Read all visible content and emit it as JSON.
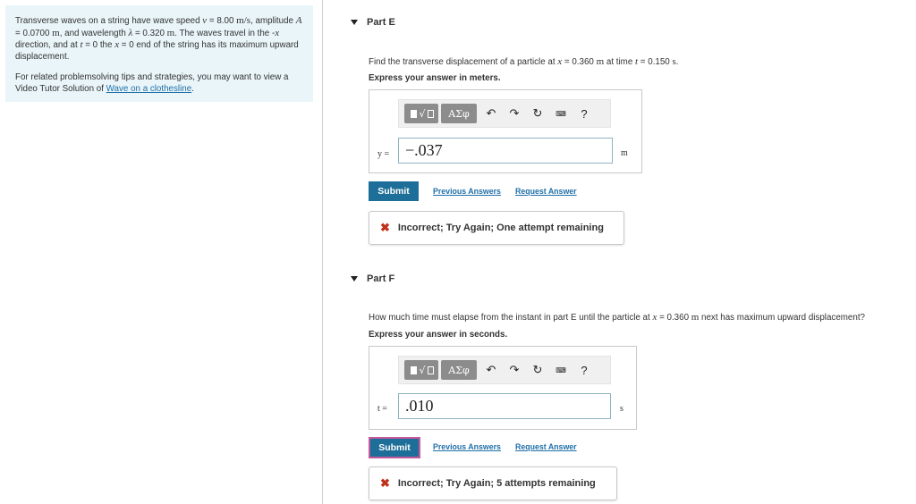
{
  "problem": {
    "intro": {
      "t1": "Transverse waves on a string have wave speed ",
      "v_sym": "v",
      "t2": " = 8.00 ",
      "v_unit": "m/s",
      "t3": ", amplitude ",
      "A_sym": "A",
      "t4": " = 0.0700 ",
      "A_unit": "m",
      "t5": ", and wavelength ",
      "lambda_sym": "λ",
      "t6": " = 0.320 ",
      "lambda_unit": "m",
      "t7": ". The waves travel in the -",
      "x_sym1": "x",
      "t8": " direction, and at ",
      "t_sym": "t",
      "t9": " = 0 the ",
      "x_sym2": "x",
      "t10": " = 0 end of the string has its maximum upward displacement."
    },
    "tips_text": "For related problemsolving tips and strategies, you may want to view a Video Tutor Solution of ",
    "tips_link": "Wave on a clothesline",
    "tips_end": "."
  },
  "part_e": {
    "title": "Part E",
    "q_t1": "Find the transverse displacement of a particle at ",
    "q_x": "x",
    "q_t2": " = 0.360 ",
    "q_unit1": "m",
    "q_t3": " at time ",
    "q_t": "t",
    "q_t4": " = 0.150 ",
    "q_unit2": "s",
    "q_t5": ".",
    "instruction": "Express your answer in meters.",
    "var_label": "y =",
    "answer_value": "−.037",
    "unit": "m",
    "submit_label": "Submit",
    "previous_answers": "Previous Answers",
    "request_answer": "Request Answer",
    "feedback": "Incorrect; Try Again; One attempt remaining"
  },
  "part_f": {
    "title": "Part F",
    "q_t1": "How much time must elapse from the instant in part E until the particle at ",
    "q_x": "x",
    "q_t2": " = 0.360 ",
    "q_unit": "m",
    "q_t3": " next has maximum upward displacement?",
    "instruction": "Express your answer in seconds.",
    "var_label": "t =",
    "answer_value": ".010",
    "unit": "s",
    "submit_label": "Submit",
    "previous_answers": "Previous Answers",
    "request_answer": "Request Answer",
    "feedback": "Incorrect; Try Again; 5 attempts remaining"
  },
  "toolbar": {
    "greek_label": "ΑΣφ",
    "help_label": "?",
    "undo_icon": "undo-icon",
    "redo_icon": "redo-icon",
    "reset_icon": "reset-icon",
    "keyboard_icon": "keyboard-icon"
  },
  "colors": {
    "panel_bg": "#e9f5f9",
    "submit_bg": "#1d6e98",
    "link": "#1f6fa8",
    "error": "#c0321b"
  }
}
